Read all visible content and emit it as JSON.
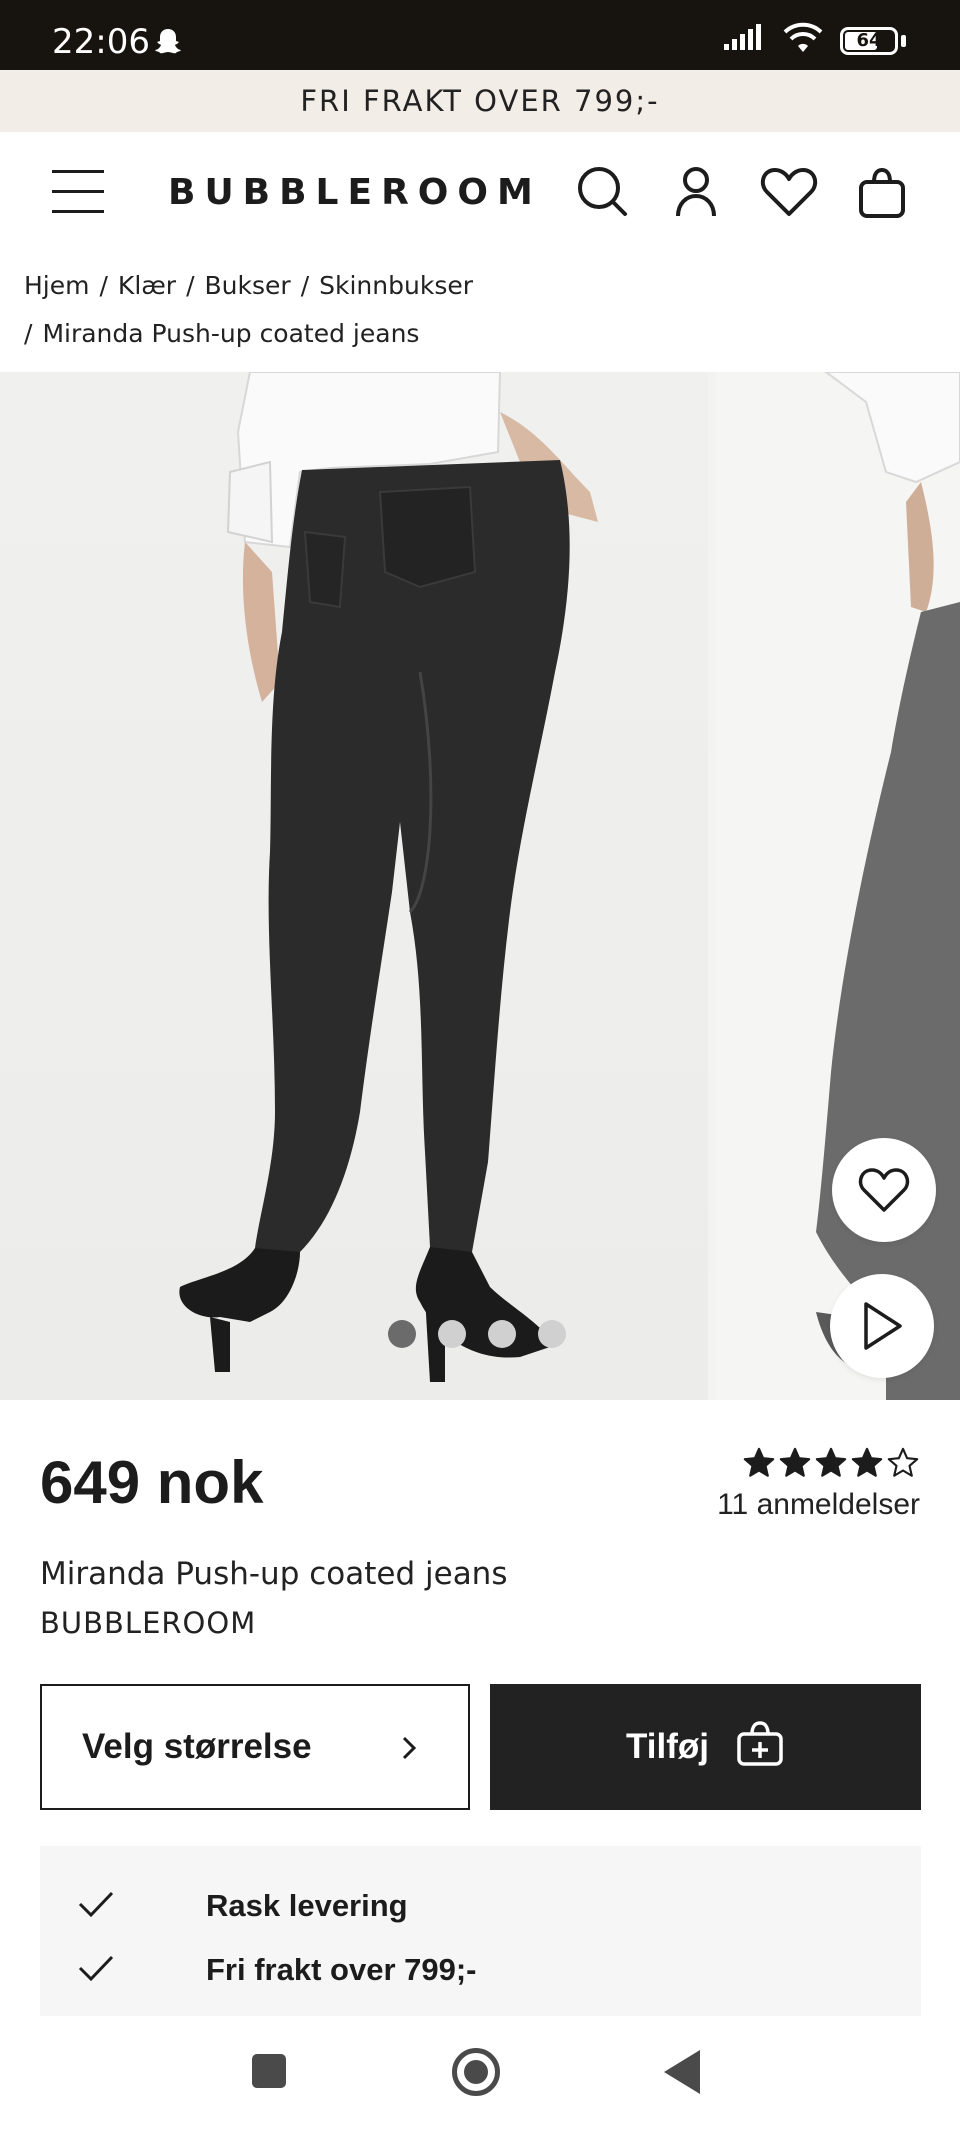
{
  "status_bar": {
    "time": "22:06",
    "battery_level": "64",
    "icons": [
      "snapchat-icon",
      "signal-icon",
      "wifi-icon",
      "battery-icon"
    ]
  },
  "promo": {
    "text": "FRI FRAKT OVER 799;-"
  },
  "header": {
    "logo": "BUBBLEROOM",
    "icons": [
      "menu-icon",
      "search-icon",
      "account-icon",
      "wishlist-icon",
      "cart-icon"
    ]
  },
  "breadcrumb": {
    "items": [
      "Hjem",
      "Klær",
      "Bukser",
      "Skinnbukser",
      "Miranda Push-up coated jeans"
    ],
    "separator": "/"
  },
  "gallery": {
    "slide_count": 4,
    "active_index": 0,
    "buttons": [
      "wishlist-heart-icon",
      "play-video-icon"
    ]
  },
  "product": {
    "price": "649 nok",
    "rating": 4,
    "rating_max": 5,
    "reviews_label": "11 anmeldelser",
    "name": "Miranda Push-up coated jeans",
    "brand": "BUBBLEROOM"
  },
  "actions": {
    "size_label": "Velg størrelse",
    "add_label": "Tilføj"
  },
  "usp": {
    "items": [
      "Rask levering",
      "Fri frakt over 799;-"
    ]
  },
  "colors": {
    "status_bar": "#17130f",
    "promo_bg": "#f3ede7",
    "primary_dark": "#222222",
    "usp_bg": "#f6f6f6"
  }
}
